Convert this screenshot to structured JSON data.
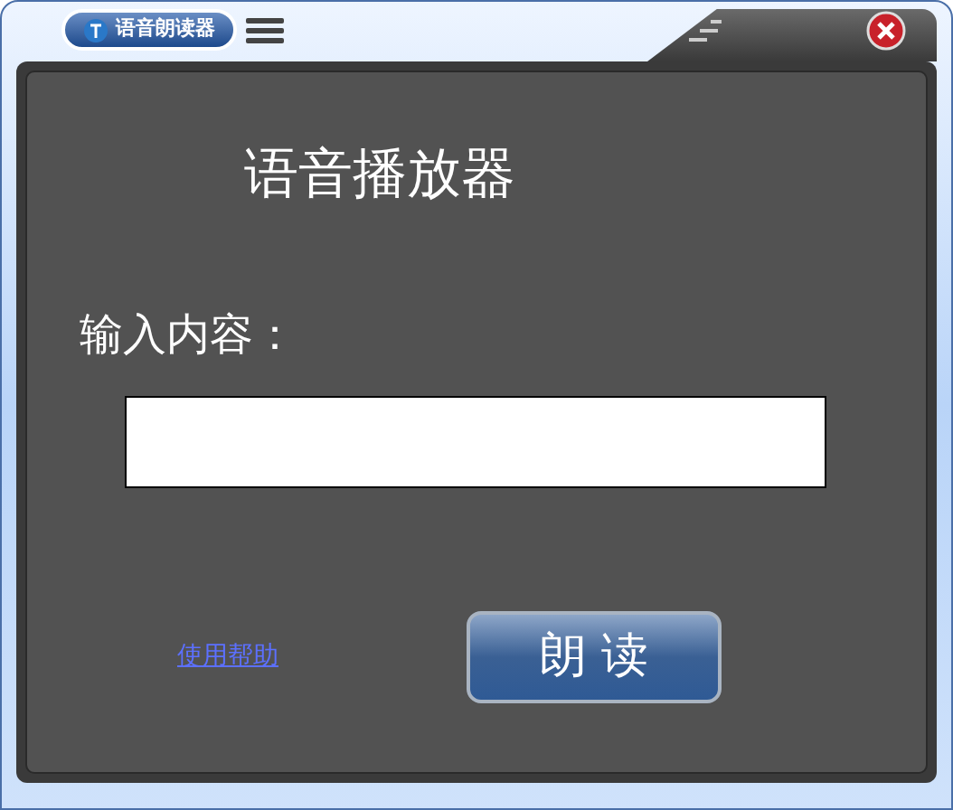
{
  "window": {
    "title": "语音朗读器"
  },
  "heading": "语音播放器",
  "input": {
    "label": "输入内容："
  },
  "help_link": "使用帮助",
  "read_button": "朗 读"
}
